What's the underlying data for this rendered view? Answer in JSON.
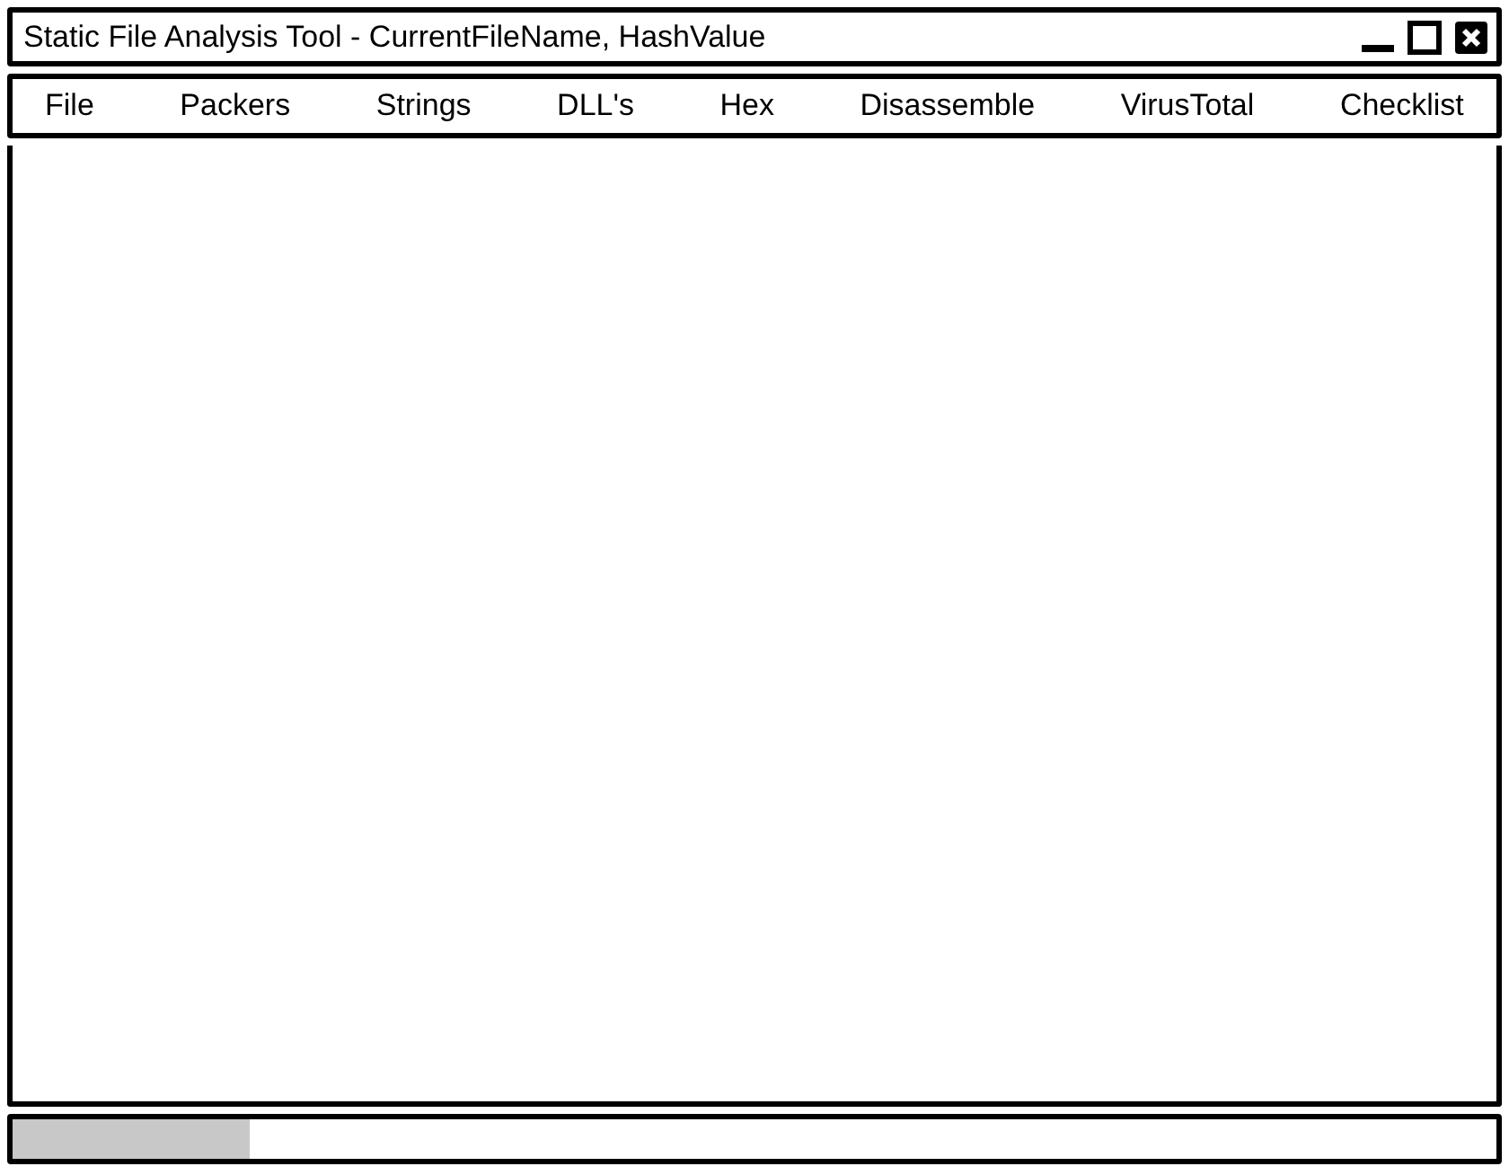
{
  "window": {
    "title": "Static File Analysis Tool - CurrentFileName, HashValue"
  },
  "menu": [
    "File",
    "Packers",
    "Strings",
    "DLL's",
    "Hex",
    "Disassemble",
    "VirusTotal",
    "Checklist"
  ],
  "progress": {
    "level": 0.16
  }
}
